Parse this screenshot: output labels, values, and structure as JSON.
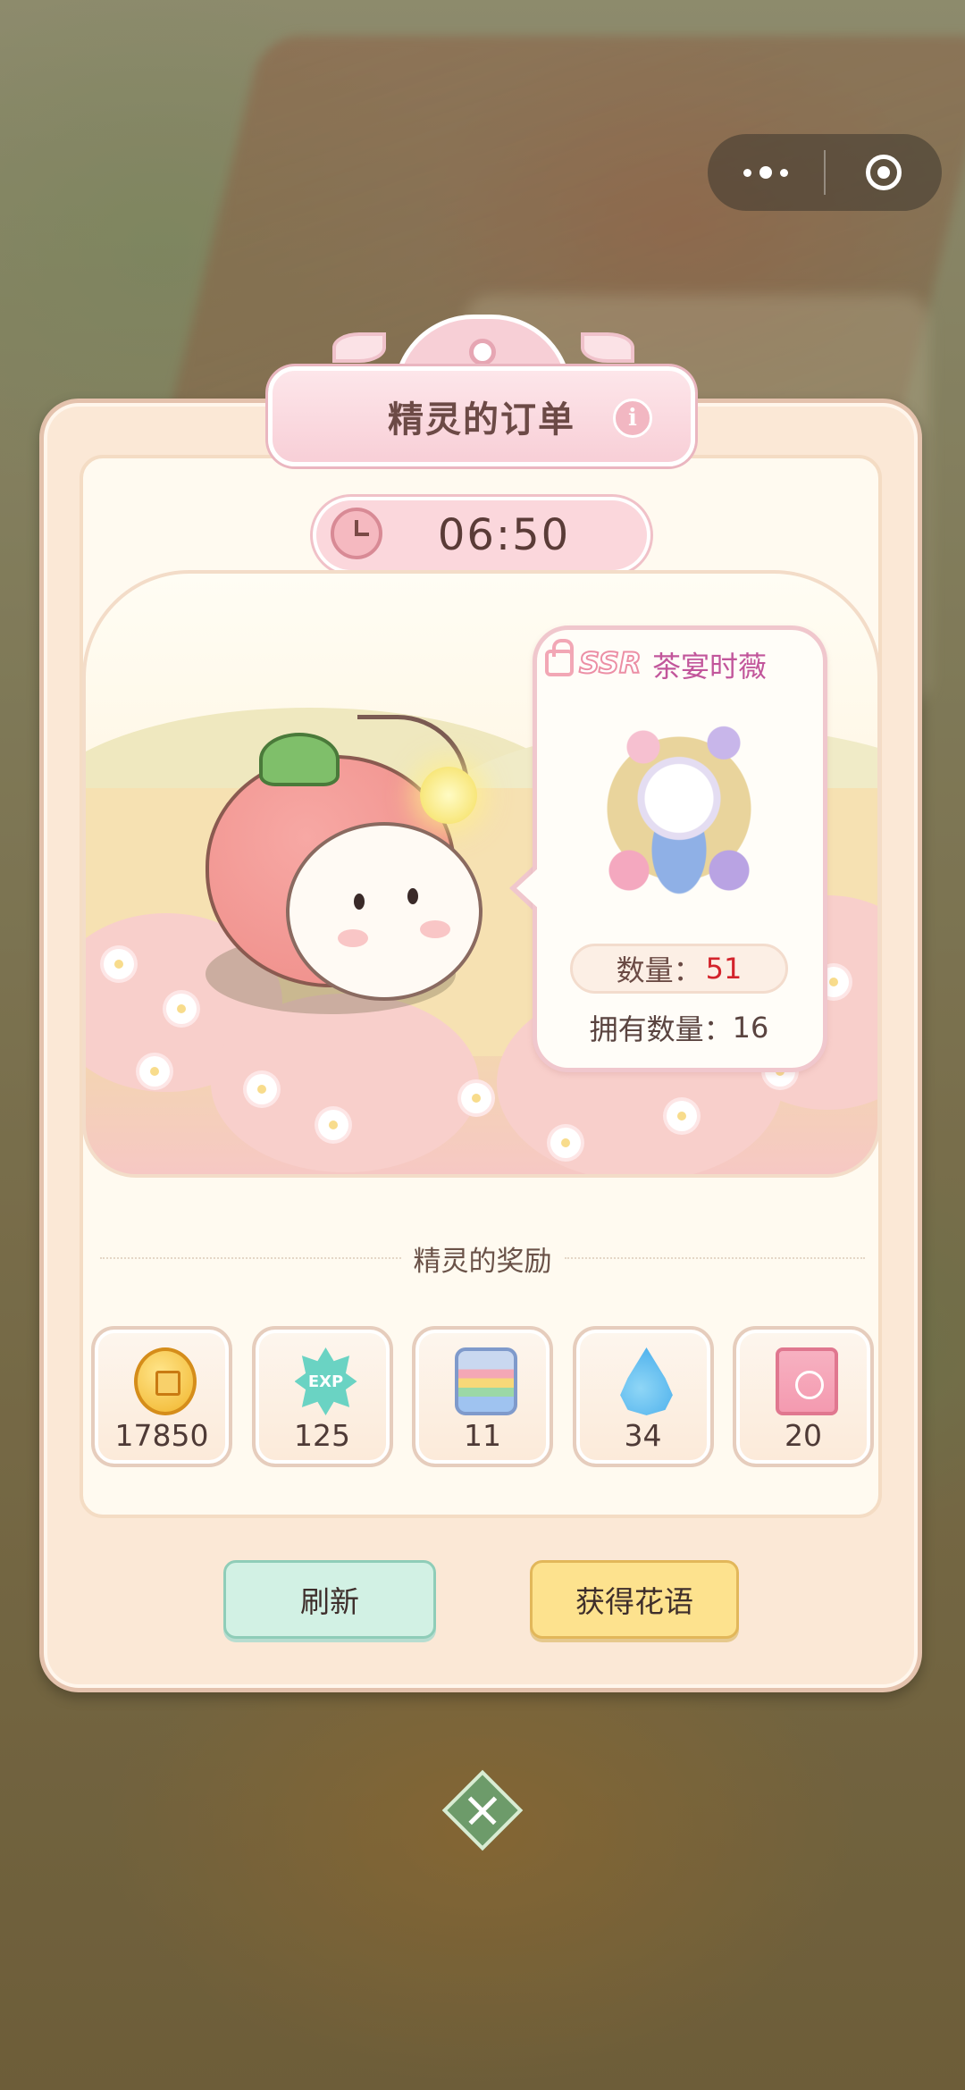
{
  "capsule": {
    "more_icon": "more-dots-icon",
    "close_icon": "target-circle-icon"
  },
  "dialog": {
    "title": "精灵的订单",
    "info_label": "i",
    "timer": "06:50"
  },
  "item": {
    "rarity": "SSR",
    "name": "茶宴时薇",
    "quantity_label": "数量：",
    "quantity_value": "51",
    "owned_label": "拥有数量：",
    "owned_value": "16"
  },
  "rewards": {
    "title": "精灵的奖励",
    "items": [
      {
        "icon": "coin-icon",
        "value": "17850"
      },
      {
        "icon": "exp-icon",
        "icon_text": "EXP",
        "value": "125"
      },
      {
        "icon": "rainbow-bag-icon",
        "value": "11"
      },
      {
        "icon": "water-drop-icon",
        "value": "34"
      },
      {
        "icon": "card-icon",
        "value": "20"
      }
    ]
  },
  "buttons": {
    "refresh": "刷新",
    "get": "获得花语"
  },
  "colors": {
    "accent_pink": "#f7cfd6",
    "refresh_green": "#d2f1e4",
    "get_yellow": "#fde28e",
    "quantity_red": "#d3242c"
  }
}
